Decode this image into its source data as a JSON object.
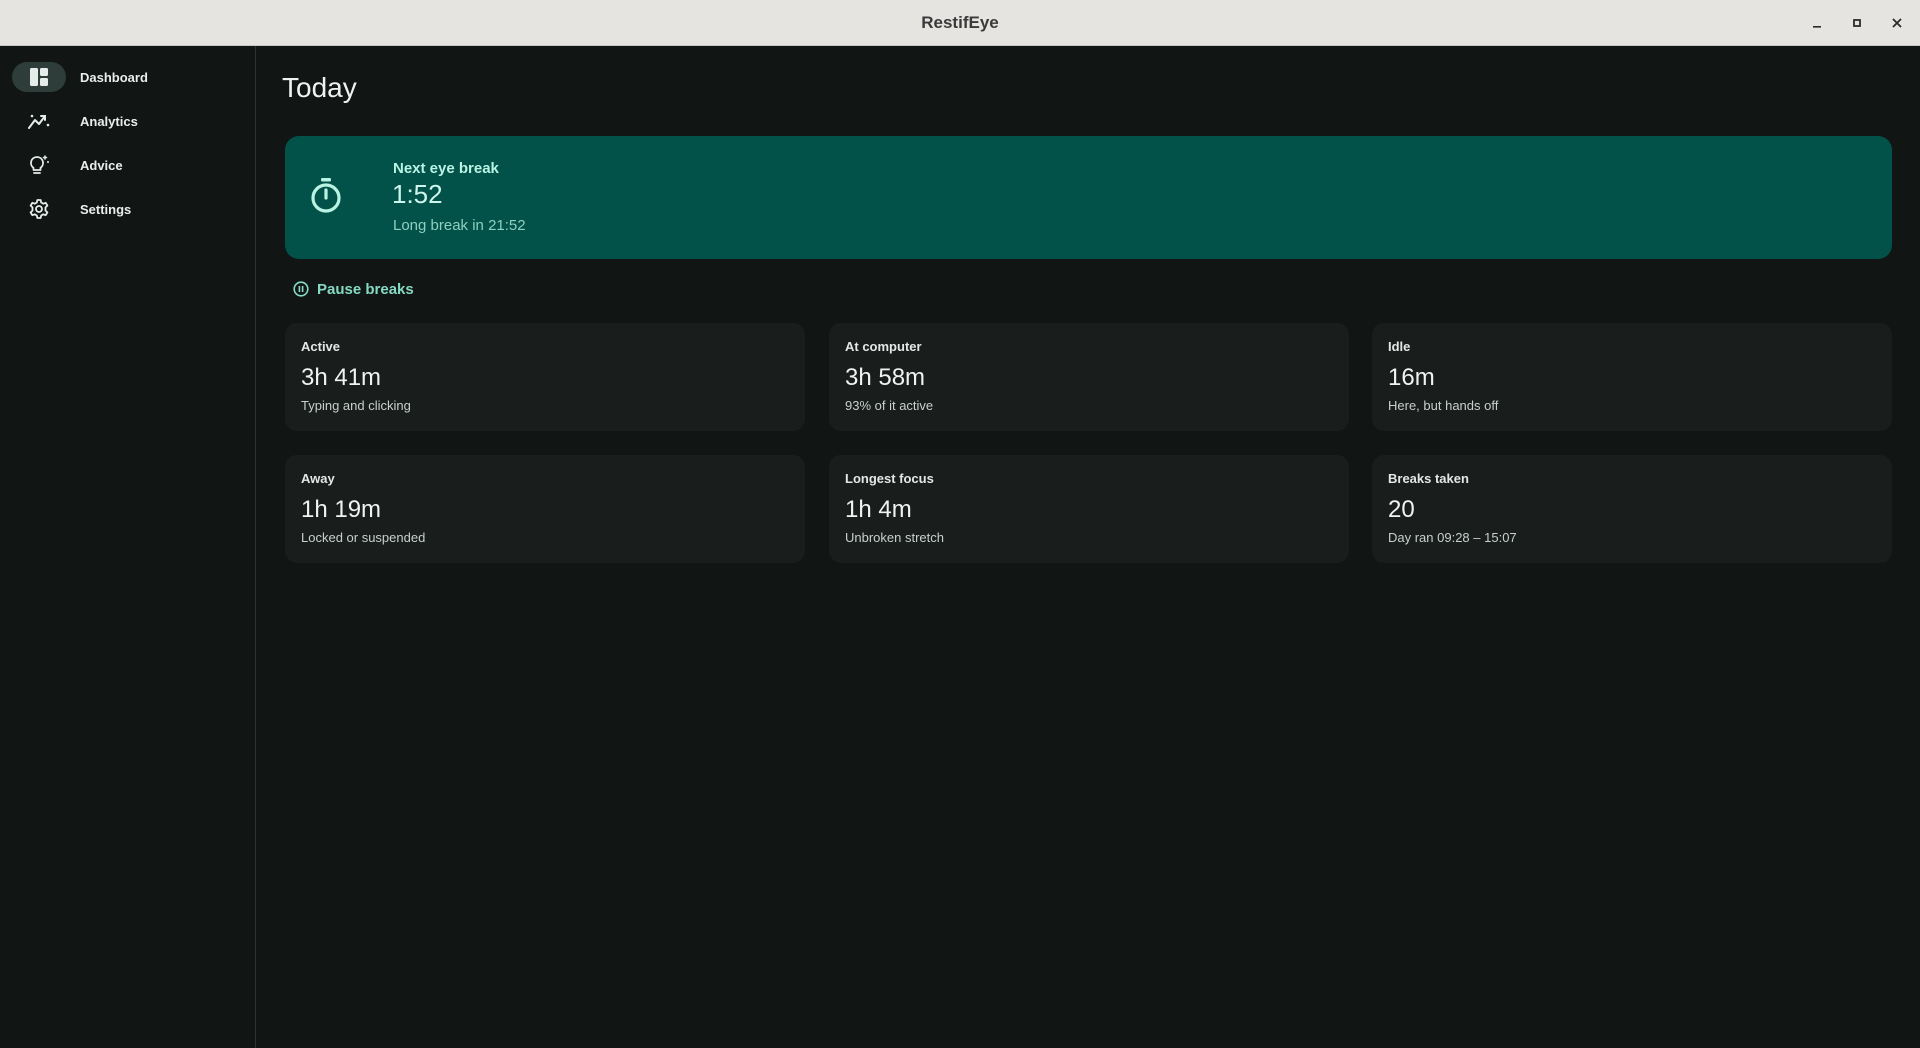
{
  "window": {
    "title": "RestifEye",
    "controls": [
      "minimize-icon",
      "maximize-icon",
      "close-icon"
    ]
  },
  "sidebar": {
    "items": [
      {
        "label": "Dashboard",
        "icon": "dashboard-icon",
        "active": true
      },
      {
        "label": "Analytics",
        "icon": "analytics-icon",
        "active": false
      },
      {
        "label": "Advice",
        "icon": "lightbulb-icon",
        "active": false
      },
      {
        "label": "Settings",
        "icon": "gear-icon",
        "active": false
      }
    ]
  },
  "main": {
    "title": "Today",
    "next_break": {
      "label": "Next eye break",
      "time": "1:52",
      "subtitle": "Long break in 21:52",
      "icon": "timer-icon"
    },
    "pause": {
      "label": "Pause breaks",
      "icon": "pause-icon"
    },
    "stats": [
      {
        "label": "Active",
        "value": "3h 41m",
        "sub": "Typing and clicking"
      },
      {
        "label": "At computer",
        "value": "3h 58m",
        "sub": "93% of it active"
      },
      {
        "label": "Idle",
        "value": "16m",
        "sub": "Here, but hands off"
      },
      {
        "label": "Away",
        "value": "1h 19m",
        "sub": "Locked or suspended"
      },
      {
        "label": "Longest focus",
        "value": "1h 4m",
        "sub": "Unbroken stretch"
      },
      {
        "label": "Breaks taken",
        "value": "20",
        "sub": "Day ran 09:28 – 15:07"
      }
    ]
  },
  "colors": {
    "accent": "#02524a",
    "accent_text": "#86d9c3",
    "background": "#111615",
    "card": "#191e1d"
  }
}
